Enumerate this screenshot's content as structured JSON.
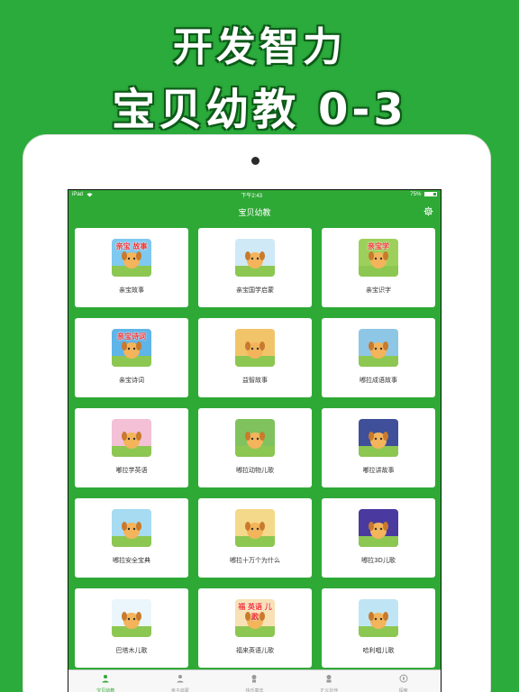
{
  "promo": {
    "line1": "开发智力",
    "line2": "宝贝幼教 0-3"
  },
  "status_bar": {
    "device": "iPad",
    "time": "下午2:43",
    "battery": "75%"
  },
  "nav": {
    "title": "宝贝幼教",
    "settings_icon": "gear-icon"
  },
  "apps": [
    {
      "label": "亲宝故事",
      "thumb_text": "亲宝 故事",
      "bg": "#7fc8f0"
    },
    {
      "label": "亲宝国学启蒙",
      "thumb_text": "",
      "bg": "#cfe9f7"
    },
    {
      "label": "亲宝识字",
      "thumb_text": "亲宝学",
      "bg": "#9dd05a"
    },
    {
      "label": "亲宝诗词",
      "thumb_text": "亲宝诗词",
      "bg": "#5fb4e8"
    },
    {
      "label": "益智故事",
      "thumb_text": "",
      "bg": "#f2c46a"
    },
    {
      "label": "嘟拉成语故事",
      "thumb_text": "",
      "bg": "#8ec6e6"
    },
    {
      "label": "嘟拉学英语",
      "thumb_text": "",
      "bg": "#f3c0d6"
    },
    {
      "label": "嘟拉动物儿歌",
      "thumb_text": "",
      "bg": "#7fc25e"
    },
    {
      "label": "嘟拉讲故事",
      "thumb_text": "",
      "bg": "#3f4f9a"
    },
    {
      "label": "嘟拉安全宝典",
      "thumb_text": "",
      "bg": "#a6dbf2"
    },
    {
      "label": "嘟拉十万个为什么",
      "thumb_text": "",
      "bg": "#f5d98a"
    },
    {
      "label": "嘟拉3D儿歌",
      "thumb_text": "",
      "bg": "#4a3aa0"
    },
    {
      "label": "巴塔木儿歌",
      "thumb_text": "",
      "bg": "#eaf6fb"
    },
    {
      "label": "福来英语儿歌",
      "thumb_text": "福 英语 儿歌",
      "bg": "#f7e1b5"
    },
    {
      "label": "哈利唱儿歌",
      "thumb_text": "",
      "bg": "#bfe5f5"
    }
  ],
  "tabs": [
    {
      "label": "宝贝幼教",
      "active": true
    },
    {
      "label": "亲子启蒙",
      "active": false
    },
    {
      "label": "快乐童年",
      "active": false
    },
    {
      "label": "正义伙伴",
      "active": false
    },
    {
      "label": "探索",
      "active": false
    }
  ],
  "colors": {
    "brand_green": "#2fa936",
    "background": "#2bab3b",
    "tab_active": "#2fa936",
    "tab_inactive": "#999999"
  }
}
